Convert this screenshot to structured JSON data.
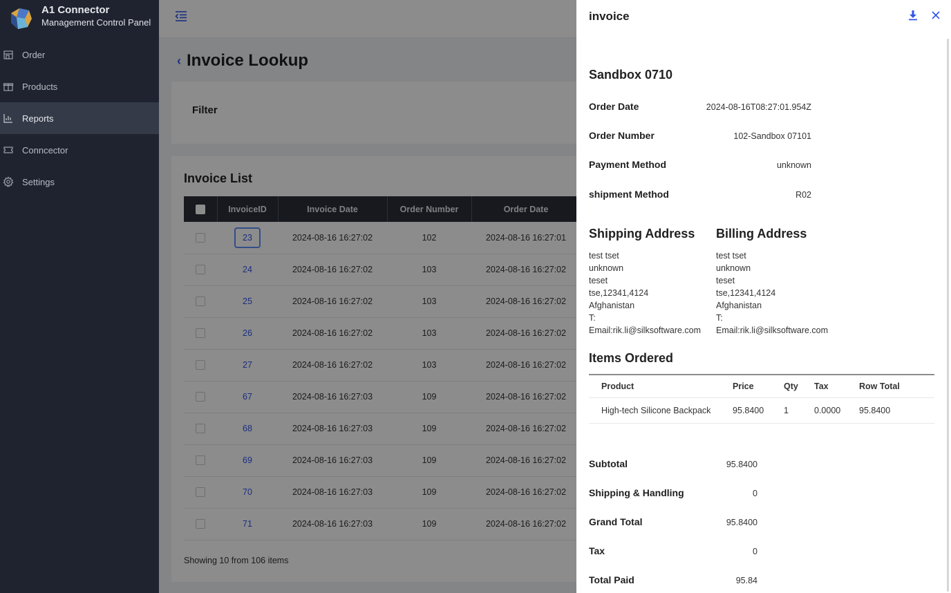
{
  "app": {
    "title": "A1 Connector",
    "subtitle": "Management Control Panel"
  },
  "sidebar": {
    "items": [
      {
        "label": "Order",
        "icon": "store-icon"
      },
      {
        "label": "Products",
        "icon": "gift-icon"
      },
      {
        "label": "Reports",
        "icon": "bar-chart-icon",
        "active": true
      },
      {
        "label": "Conncector",
        "icon": "ticket-icon"
      },
      {
        "label": "Settings",
        "icon": "gear-icon"
      }
    ]
  },
  "page": {
    "title": "Invoice Lookup",
    "filter_title": "Filter",
    "list_title": "Invoice List",
    "showing": "Showing 10 from 106 items"
  },
  "table": {
    "headers": [
      "InvoiceID",
      "Invoice Date",
      "Order Number",
      "Order Date"
    ],
    "rows": [
      {
        "id": "23",
        "invoice_date": "2024-08-16 16:27:02",
        "order_number": "102",
        "order_date": "2024-08-16 16:27:01"
      },
      {
        "id": "24",
        "invoice_date": "2024-08-16 16:27:02",
        "order_number": "103",
        "order_date": "2024-08-16 16:27:02"
      },
      {
        "id": "25",
        "invoice_date": "2024-08-16 16:27:02",
        "order_number": "103",
        "order_date": "2024-08-16 16:27:02"
      },
      {
        "id": "26",
        "invoice_date": "2024-08-16 16:27:02",
        "order_number": "103",
        "order_date": "2024-08-16 16:27:02"
      },
      {
        "id": "27",
        "invoice_date": "2024-08-16 16:27:02",
        "order_number": "103",
        "order_date": "2024-08-16 16:27:02"
      },
      {
        "id": "67",
        "invoice_date": "2024-08-16 16:27:03",
        "order_number": "109",
        "order_date": "2024-08-16 16:27:02"
      },
      {
        "id": "68",
        "invoice_date": "2024-08-16 16:27:03",
        "order_number": "109",
        "order_date": "2024-08-16 16:27:02"
      },
      {
        "id": "69",
        "invoice_date": "2024-08-16 16:27:03",
        "order_number": "109",
        "order_date": "2024-08-16 16:27:02"
      },
      {
        "id": "70",
        "invoice_date": "2024-08-16 16:27:03",
        "order_number": "109",
        "order_date": "2024-08-16 16:27:02"
      },
      {
        "id": "71",
        "invoice_date": "2024-08-16 16:27:03",
        "order_number": "109",
        "order_date": "2024-08-16 16:27:02"
      }
    ]
  },
  "drawer": {
    "title": "invoice",
    "store": "Sandbox 0710",
    "order_date_label": "Order Date",
    "order_date": "2024-08-16T08:27:01.954Z",
    "order_number_label": "Order Number",
    "order_number": "102-Sandbox 07101",
    "payment_label": "Payment Method",
    "payment": "unknown",
    "shipment_label": "shipment Method",
    "shipment": "R02",
    "shipping_title": "Shipping Address",
    "billing_title": "Billing Address",
    "shipping_lines": [
      "test tset",
      "unknown",
      "teset",
      "tse,12341,4124",
      "Afghanistan",
      "T:",
      "Email:rik.li@silksoftware.com"
    ],
    "billing_lines": [
      "test tset",
      "unknown",
      "teset",
      "tse,12341,4124",
      "Afghanistan",
      "T:",
      "Email:rik.li@silksoftware.com"
    ],
    "items_title": "Items Ordered",
    "items_headers": [
      "Product",
      "Price",
      "Qty",
      "Tax",
      "Row Total"
    ],
    "items": [
      {
        "product": "High-tech Silicone Backpack",
        "price": "95.8400",
        "qty": "1",
        "tax": "0.0000",
        "row_total": "95.8400"
      }
    ],
    "totals": {
      "subtotal_label": "Subtotal",
      "subtotal": "95.8400",
      "shipping_label": "Shipping & Handling",
      "shipping": "0",
      "grand_label": "Grand Total",
      "grand": "95.8400",
      "tax_label": "Tax",
      "tax": "0",
      "paid_label": "Total Paid",
      "paid": "95.84"
    }
  },
  "colors": {
    "sidebar_bg": "#1f2330",
    "accent": "#2f54eb",
    "table_header": "#2b2f3a"
  }
}
